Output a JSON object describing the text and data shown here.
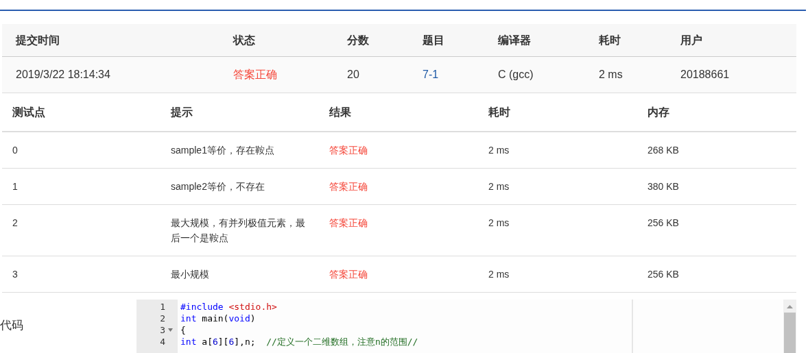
{
  "submission": {
    "columns": [
      "提交时间",
      "状态",
      "分数",
      "题目",
      "编译器",
      "耗时",
      "用户"
    ],
    "row": {
      "time": "2019/3/22 18:14:34",
      "status": "答案正确",
      "score": "20",
      "problem": "7-1",
      "compiler": "C (gcc)",
      "duration": "2 ms",
      "user": "20188661"
    }
  },
  "tests": {
    "columns": [
      "测试点",
      "提示",
      "结果",
      "耗时",
      "内存"
    ],
    "rows": [
      {
        "id": "0",
        "hint": "sample1等价，存在鞍点",
        "result": "答案正确",
        "duration": "2 ms",
        "memory": "268 KB"
      },
      {
        "id": "1",
        "hint": "sample2等价，不存在",
        "result": "答案正确",
        "duration": "2 ms",
        "memory": "380 KB"
      },
      {
        "id": "2",
        "hint": "最大规模，有并列极值元素，最后一个是鞍点",
        "result": "答案正确",
        "duration": "2 ms",
        "memory": "256 KB"
      },
      {
        "id": "3",
        "hint": "最小规模",
        "result": "答案正确",
        "duration": "2 ms",
        "memory": "256 KB"
      }
    ]
  },
  "code": {
    "label": "代码",
    "lines": [
      {
        "number": "1",
        "fold": false,
        "tokens": [
          {
            "kind": "keyword",
            "text": "#include"
          },
          {
            "kind": "string",
            "text": "<stdio.h>",
            "space_before": true
          }
        ]
      },
      {
        "number": "2",
        "fold": false,
        "tokens": [
          {
            "kind": "keyword",
            "text": "int"
          },
          {
            "kind": "plain",
            "text": " main("
          },
          {
            "kind": "keyword",
            "text": "void"
          },
          {
            "kind": "plain",
            "text": ")"
          }
        ]
      },
      {
        "number": "3",
        "fold": true,
        "tokens": [
          {
            "kind": "plain",
            "text": "{"
          }
        ]
      },
      {
        "number": "4",
        "fold": false,
        "tokens": [
          {
            "kind": "keyword",
            "text": "int"
          },
          {
            "kind": "plain",
            "text": " a["
          },
          {
            "kind": "number",
            "text": "6"
          },
          {
            "kind": "plain",
            "text": "]["
          },
          {
            "kind": "number",
            "text": "6"
          },
          {
            "kind": "plain",
            "text": "],n;  "
          },
          {
            "kind": "comment",
            "text": "//定义一个二维数组，注意n的范围//"
          }
        ]
      }
    ]
  }
}
